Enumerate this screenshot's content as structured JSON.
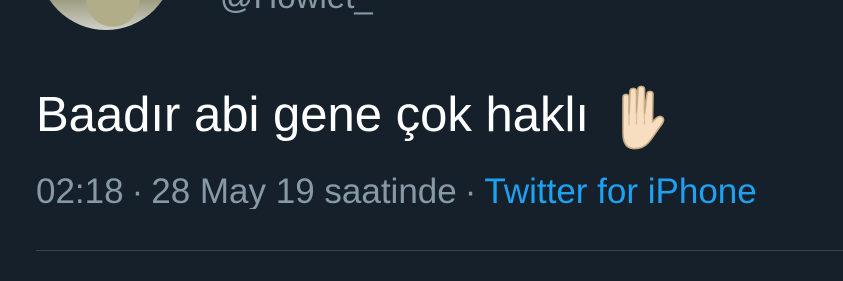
{
  "tweet": {
    "handle": "@Howlet_",
    "text": "Baadır abi gene çok haklı",
    "emoji_icon": "raised-hand-icon",
    "meta": {
      "time": "02:18",
      "separator": "·",
      "date": "28 May 19 saatinde",
      "source": "Twitter for iPhone"
    }
  },
  "colors": {
    "background": "#15202b",
    "primary_text": "#ffffff",
    "secondary_text": "#8899a6",
    "link": "#1da1f2",
    "divider": "#38444d"
  }
}
